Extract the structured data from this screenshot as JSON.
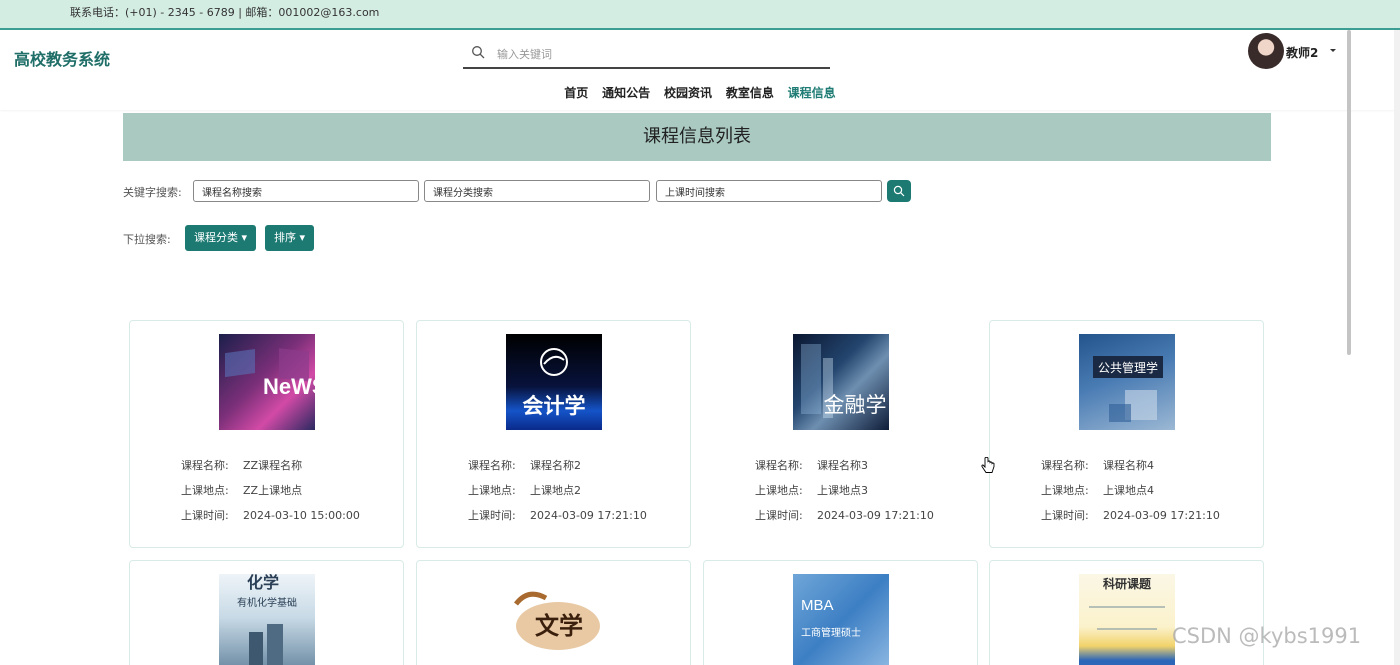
{
  "topbar": {
    "contact": "联系电话：(+01) - 2345 - 6789 | 邮箱：001002@163.com"
  },
  "header": {
    "logo": "高校教务系统",
    "search_placeholder": "输入关键词",
    "username": "教师2"
  },
  "nav": {
    "items": [
      "首页",
      "通知公告",
      "校园资讯",
      "教室信息",
      "课程信息"
    ],
    "active": "课程信息"
  },
  "banner": {
    "title": "课程信息列表"
  },
  "filters": {
    "keyword_label": "关键字搜索:",
    "inputs": [
      "课程名称搜索",
      "课程分类搜索",
      "上课时间搜索"
    ],
    "dropdown_label": "下拉搜索:",
    "dropdowns": [
      "课程分类",
      "排序"
    ]
  },
  "field_labels": {
    "name": "课程名称:",
    "place": "上课地点:",
    "time": "上课时间:"
  },
  "courses": [
    {
      "name": "ZZ课程名称",
      "place": "ZZ上课地点",
      "time": "2024-03-10 15:00:00",
      "cover_text": "NeWS"
    },
    {
      "name": "课程名称2",
      "place": "上课地点2",
      "time": "2024-03-09 17:21:10",
      "cover_text": "会计学"
    },
    {
      "name": "课程名称3",
      "place": "上课地点3",
      "time": "2024-03-09 17:21:10",
      "cover_text": "金融学"
    },
    {
      "name": "课程名称4",
      "place": "上课地点4",
      "time": "2024-03-09 17:21:10",
      "cover_text": "公共管理学"
    },
    {
      "cover_text": "化学",
      "cover_sub": "有机化学基础"
    },
    {
      "cover_text": "文学"
    },
    {
      "cover_text": "MBA",
      "cover_sub": "工商管理硕士"
    },
    {
      "cover_text": "科研课题"
    }
  ],
  "watermark": "CSDN @kybs1991",
  "colors": {
    "accent": "#1d7a73",
    "banner": "#a9c9c1",
    "topbar": "#d4ede3"
  }
}
